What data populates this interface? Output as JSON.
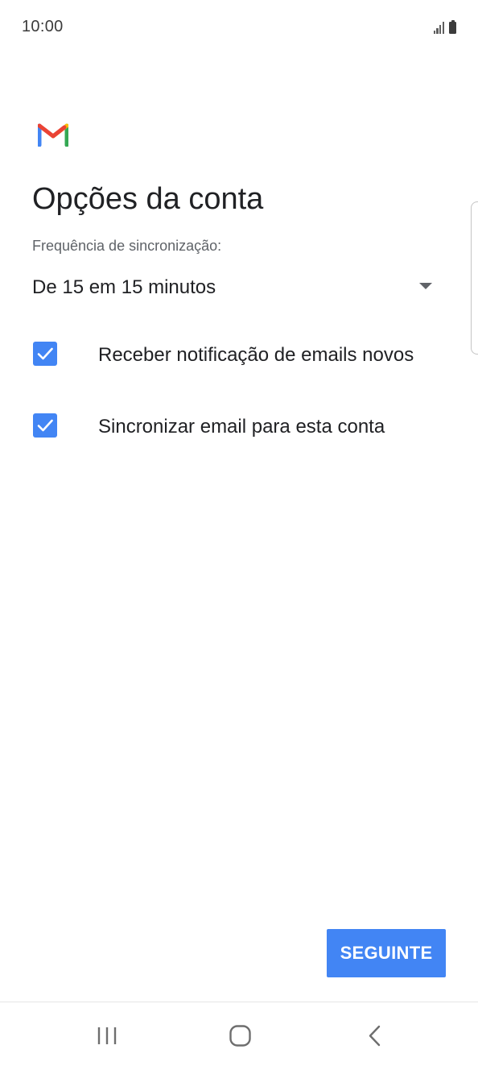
{
  "status_bar": {
    "time": "10:00",
    "icons": [
      "signal-icon",
      "battery-icon"
    ]
  },
  "header": {
    "logo": "gmail-logo-icon",
    "title": "Opções da conta"
  },
  "sync": {
    "label": "Frequência de sincronização:",
    "selected": "De 15 em 15 minutos"
  },
  "options": [
    {
      "label": "Receber notificação de emails novos",
      "checked": true
    },
    {
      "label": "Sincronizar email para esta conta",
      "checked": true
    }
  ],
  "actions": {
    "next_label": "SEGUINTE"
  },
  "nav_bar": {
    "icons": [
      "recent-apps-icon",
      "home-icon",
      "back-icon"
    ]
  },
  "colors": {
    "accent": "#4285f4",
    "text": "#202124",
    "secondary_text": "#5f6368"
  }
}
